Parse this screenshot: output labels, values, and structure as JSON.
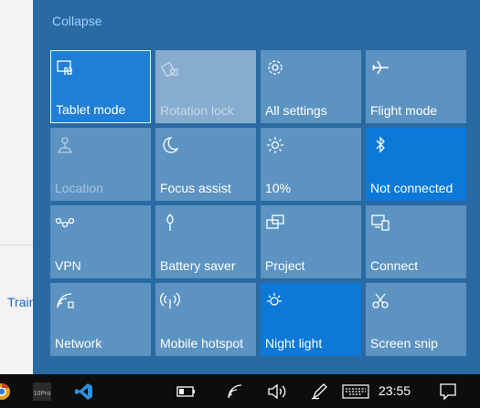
{
  "background_app": {
    "link_text": "Train"
  },
  "action_center": {
    "collapse_label": "Collapse",
    "tiles": [
      {
        "label": "Tablet mode",
        "icon": "tablet-mode-icon",
        "state": "selected"
      },
      {
        "label": "Rotation lock",
        "icon": "rotation-lock-icon",
        "state": "disabled"
      },
      {
        "label": "All settings",
        "icon": "gear-icon",
        "state": "off"
      },
      {
        "label": "Flight mode",
        "icon": "airplane-icon",
        "state": "off"
      },
      {
        "label": "Location",
        "icon": "location-icon",
        "state": "disabled"
      },
      {
        "label": "Focus assist",
        "icon": "moon-icon",
        "state": "off"
      },
      {
        "label": "10%",
        "icon": "brightness-icon",
        "state": "off"
      },
      {
        "label": "Not connected",
        "icon": "bluetooth-icon",
        "state": "on"
      },
      {
        "label": "VPN",
        "icon": "vpn-icon",
        "state": "off"
      },
      {
        "label": "Battery saver",
        "icon": "battery-saver-icon",
        "state": "off"
      },
      {
        "label": "Project",
        "icon": "project-icon",
        "state": "off"
      },
      {
        "label": "Connect",
        "icon": "connect-icon",
        "state": "off"
      },
      {
        "label": "Network",
        "icon": "network-icon",
        "state": "off"
      },
      {
        "label": "Mobile hotspot",
        "icon": "mobile-hotspot-icon",
        "state": "off"
      },
      {
        "label": "Night light",
        "icon": "night-light-icon",
        "state": "on"
      },
      {
        "label": "Screen snip",
        "icon": "screen-snip-icon",
        "state": "off"
      }
    ]
  },
  "taskbar": {
    "clock": "23:55",
    "pinned": [
      {
        "icon": "chrome-icon"
      },
      {
        "icon": "xmind-icon",
        "label": "10Pro"
      },
      {
        "icon": "vscode-icon"
      }
    ],
    "tray": [
      {
        "icon": "battery-icon"
      },
      {
        "icon": "wifi-icon"
      },
      {
        "icon": "volume-icon"
      },
      {
        "icon": "pen-icon"
      },
      {
        "icon": "keyboard-icon"
      },
      {
        "icon": "notifications-icon"
      }
    ]
  },
  "colors": {
    "panel": "#2a6aa2",
    "tile": "#5c93c1",
    "tile_active": "#0c78d8",
    "collapse_link": "#9fd0ff",
    "taskbar": "#0d0d0d"
  }
}
